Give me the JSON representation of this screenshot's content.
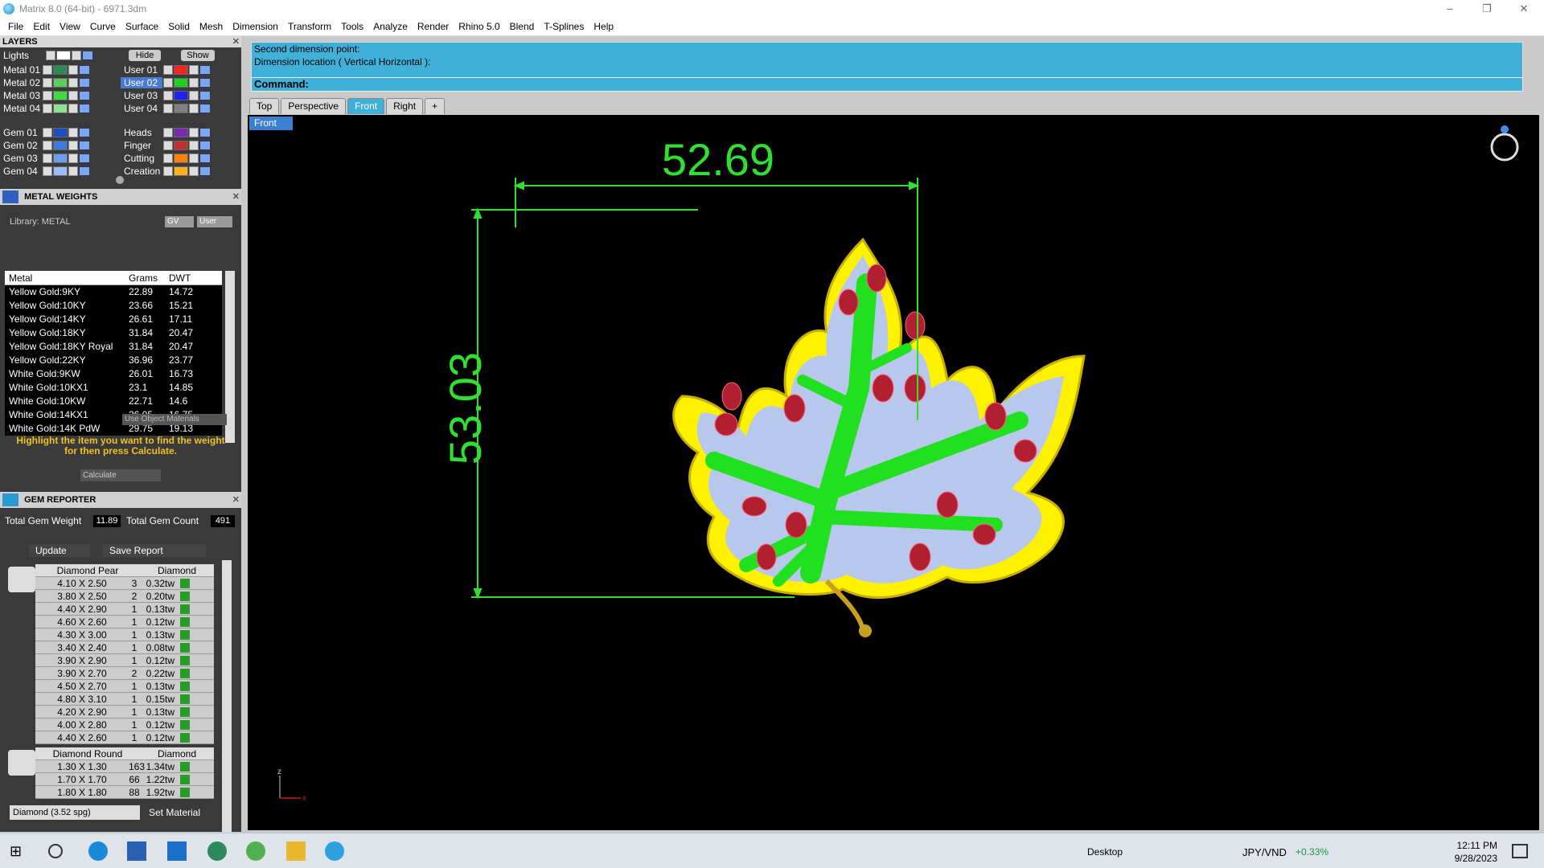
{
  "window": {
    "title": "Matrix 8.0 (64-bit) - 6971.3dm",
    "minimize": "–",
    "restore": "❐",
    "close": "✕"
  },
  "menu": [
    "File",
    "Edit",
    "View",
    "Curve",
    "Surface",
    "Solid",
    "Mesh",
    "Dimension",
    "Transform",
    "Tools",
    "Analyze",
    "Render",
    "Rhino 5.0",
    "Blend",
    "T-Splines",
    "Help"
  ],
  "layers": {
    "title": "LAYERS",
    "lights": "Lights",
    "hide": "Hide",
    "show": "Show",
    "left": [
      {
        "name": "Metal 01",
        "color": "#2e8b57"
      },
      {
        "name": "Metal 02",
        "color": "#5ccc5c"
      },
      {
        "name": "Metal 03",
        "color": "#3fdc3f"
      },
      {
        "name": "Metal 04",
        "color": "#8fe08f"
      },
      {
        "name": "Gem 01",
        "color": "#1e4fc0"
      },
      {
        "name": "Gem 02",
        "color": "#3d7ae0"
      },
      {
        "name": "Gem 03",
        "color": "#6a9ef0"
      },
      {
        "name": "Gem 04",
        "color": "#9dbdf8"
      }
    ],
    "right": [
      {
        "name": "User 01",
        "color": "#ff2020"
      },
      {
        "name": "User 02",
        "color": "#20d020"
      },
      {
        "name": "User 03",
        "color": "#2020ff"
      },
      {
        "name": "User 04",
        "color": "#808080"
      },
      {
        "name": "Heads",
        "color": "#7a2ab0"
      },
      {
        "name": "Finger",
        "color": "#c03030"
      },
      {
        "name": "Cutting",
        "color": "#ff8000"
      },
      {
        "name": "Creation",
        "color": "#ffb020"
      }
    ]
  },
  "metal_weights": {
    "title": "METAL WEIGHTS",
    "library": "Library: METAL",
    "gv": "GV",
    "user": "User",
    "headers": [
      "Metal",
      "Grams",
      "DWT"
    ],
    "rows": [
      [
        "Yellow Gold:9KY",
        "22.89",
        "14.72"
      ],
      [
        "Yellow Gold:10KY",
        "23.66",
        "15.21"
      ],
      [
        "Yellow Gold:14KY",
        "26.61",
        "17.11"
      ],
      [
        "Yellow Gold:18KY",
        "31.84",
        "20.47"
      ],
      [
        "Yellow Gold:18KY Royal",
        "31.84",
        "20.47"
      ],
      [
        "Yellow Gold:22KY",
        "36.96",
        "23.77"
      ],
      [
        "White Gold:9KW",
        "26.01",
        "16.73"
      ],
      [
        "White Gold:10KX1",
        "23.1",
        "14.85"
      ],
      [
        "White Gold:10KW",
        "22.71",
        "14.6"
      ],
      [
        "White Gold:14KX1",
        "26.05",
        "16.75"
      ],
      [
        "White Gold:14K PdW",
        "29.75",
        "19.13"
      ]
    ],
    "use_object_materials": "Use Object Materials",
    "hint": "Highlight the item you want to find the weight for then press Calculate.",
    "calculate": "Calculate"
  },
  "gem_reporter": {
    "title": "GEM REPORTER",
    "total_weight_label": "Total Gem Weight",
    "total_weight": "11.89",
    "total_count_label": "Total Gem Count",
    "total_count": "491",
    "update": "Update",
    "save_report": "Save Report",
    "group1": {
      "shape": "Diamond Pear",
      "material": "Diamond",
      "rows": [
        [
          "4.10 X 2.50",
          "3",
          "0.32tw"
        ],
        [
          "3.80 X 2.50",
          "2",
          "0.20tw"
        ],
        [
          "4.40 X 2.90",
          "1",
          "0.13tw"
        ],
        [
          "4.60 X 2.60",
          "1",
          "0.12tw"
        ],
        [
          "4.30 X 3.00",
          "1",
          "0.13tw"
        ],
        [
          "3.40 X 2.40",
          "1",
          "0.08tw"
        ],
        [
          "3.90 X 2.90",
          "1",
          "0.12tw"
        ],
        [
          "3.90 X 2.70",
          "2",
          "0.22tw"
        ],
        [
          "4.50 X 2.70",
          "1",
          "0.13tw"
        ],
        [
          "4.80 X 3.10",
          "1",
          "0.15tw"
        ],
        [
          "4.20 X 2.90",
          "1",
          "0.13tw"
        ],
        [
          "4.00 X 2.80",
          "1",
          "0.12tw"
        ],
        [
          "4.40 X 2.60",
          "1",
          "0.12tw"
        ]
      ]
    },
    "group2": {
      "shape": "Diamond Round",
      "material": "Diamond",
      "rows": [
        [
          "1.30 X 1.30",
          "163",
          "1.34tw"
        ],
        [
          "1.70 X 1.70",
          "66",
          "1.22tw"
        ],
        [
          "1.80 X 1.80",
          "88",
          "1.92tw"
        ]
      ]
    },
    "material_select": "Diamond    (3.52 spg)",
    "set_material": "Set Material"
  },
  "command": {
    "line1": "Second dimension point:",
    "line2": "Dimension location ( Vertical  Horizontal ):",
    "prompt": "Command:"
  },
  "tabs": [
    "Top",
    "Perspective",
    "Front",
    "Right",
    "+"
  ],
  "viewport": {
    "label": "Front",
    "dim_width": "52.69",
    "dim_height": "53.03",
    "axis_z": "z",
    "axis_x": "x"
  },
  "taskbar": {
    "desktop": "Desktop",
    "currency": "JPY/VND",
    "change": "+0.33%",
    "time": "12:11 PM",
    "date": "9/28/2023"
  }
}
